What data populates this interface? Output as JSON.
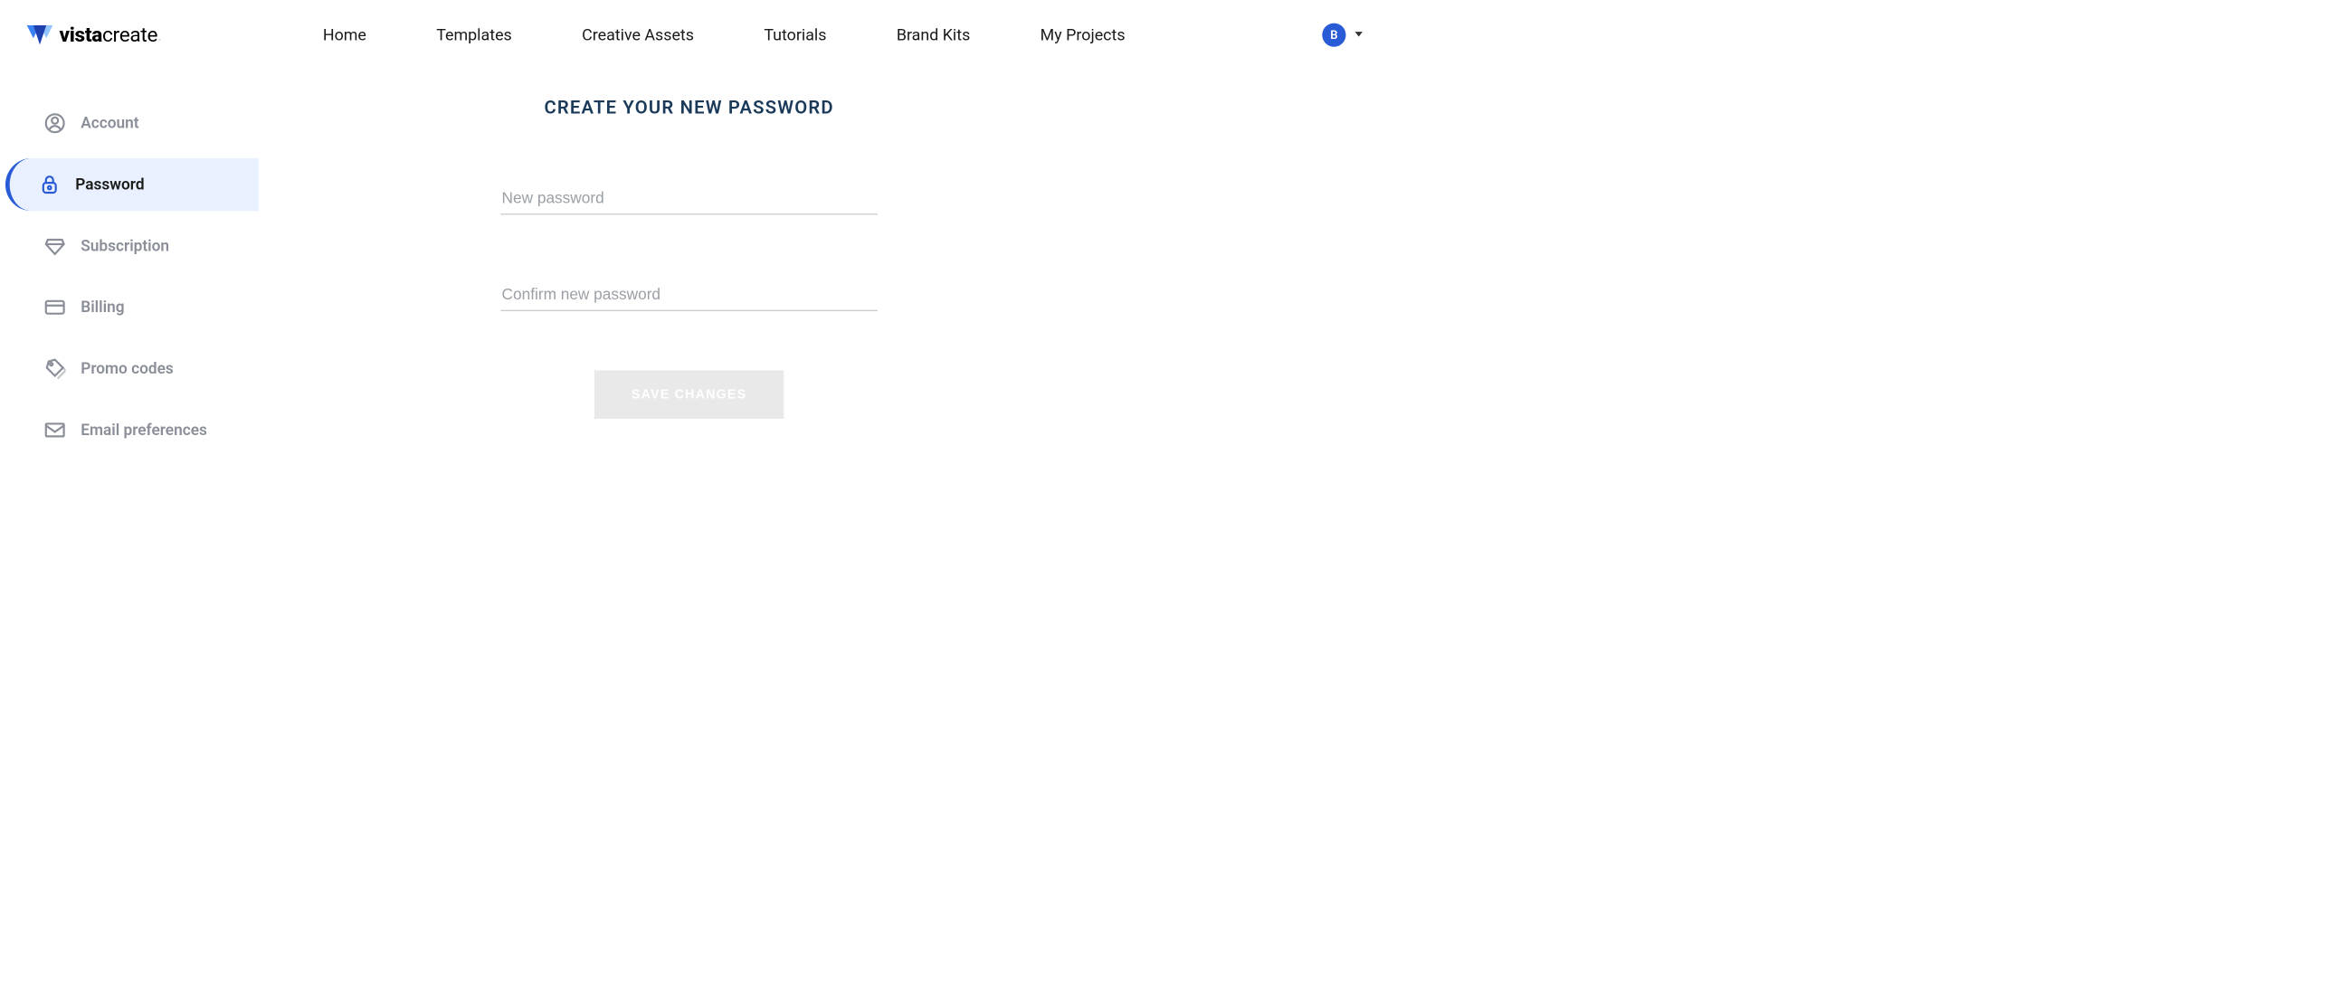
{
  "brand": {
    "name_prefix": "vista",
    "name_suffix": "create",
    "trademark": "™"
  },
  "nav": [
    {
      "label": "Home"
    },
    {
      "label": "Templates"
    },
    {
      "label": "Creative Assets"
    },
    {
      "label": "Tutorials"
    },
    {
      "label": "Brand Kits"
    },
    {
      "label": "My Projects"
    }
  ],
  "user": {
    "initial": "B"
  },
  "sidebar": {
    "items": [
      {
        "label": "Account",
        "icon": "user-icon",
        "active": false
      },
      {
        "label": "Password",
        "icon": "lock-icon",
        "active": true
      },
      {
        "label": "Subscription",
        "icon": "diamond-icon",
        "active": false
      },
      {
        "label": "Billing",
        "icon": "card-icon",
        "active": false
      },
      {
        "label": "Promo codes",
        "icon": "tag-icon",
        "active": false
      },
      {
        "label": "Email preferences",
        "icon": "mail-icon",
        "active": false
      }
    ]
  },
  "main": {
    "title": "CREATE YOUR NEW PASSWORD",
    "fields": {
      "new_password_placeholder": "New password",
      "confirm_password_placeholder": "Confirm new password"
    },
    "save_label": "SAVE CHANGES"
  }
}
